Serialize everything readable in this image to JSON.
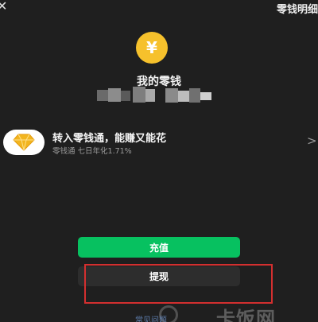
{
  "header": {
    "back_icon": "close-icon",
    "detail_label": "零钱明细"
  },
  "wallet": {
    "coin_icon": "yen-coin-icon",
    "coin_symbol": "¥",
    "title": "我的零钱",
    "balance_display": "blurred"
  },
  "promo": {
    "icon": "diamond-icon",
    "title": "转入零钱通，能赚又能花",
    "subtitle": "零钱通 七日年化1.71%",
    "arrow": ">"
  },
  "actions": {
    "recharge_label": "充值",
    "withdraw_label": "提现"
  },
  "footer": {
    "faq_label": "常见问题"
  },
  "watermark": {
    "text": "卡饭网"
  },
  "colors": {
    "background": "#1f1f1f",
    "primary_green": "#07c160",
    "coin_yellow": "#f6c12c",
    "highlight_red": "#d32f2f"
  }
}
